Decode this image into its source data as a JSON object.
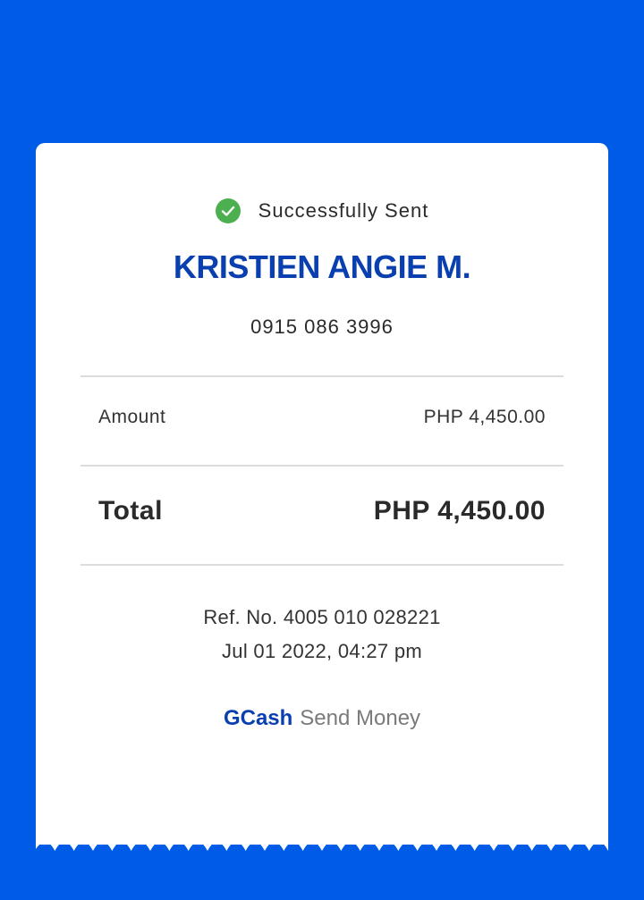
{
  "status": {
    "icon": "check-circle-icon",
    "text": "Successfully Sent",
    "color": "#4caf50"
  },
  "recipient": {
    "name": "KRISTIEN ANGIE M.",
    "phone": "0915 086 3996"
  },
  "breakdown": {
    "amount_label": "Amount",
    "amount_value": "PHP 4,450.00",
    "total_label": "Total",
    "total_value": "PHP 4,450.00"
  },
  "reference": {
    "ref_no": "Ref. No. 4005 010 028221",
    "datetime": "Jul 01 2022, 04:27 pm"
  },
  "footer": {
    "brand": "GCash",
    "service": "Send Money"
  },
  "colors": {
    "background": "#005ce6",
    "accent": "#0a3fb0",
    "success": "#4caf50"
  }
}
